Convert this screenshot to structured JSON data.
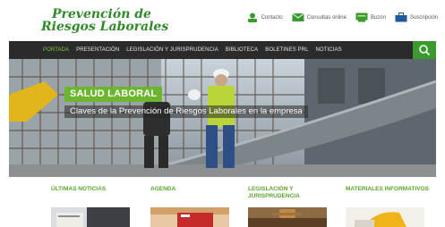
{
  "brand": {
    "logo_line1": "Prevención de",
    "logo_line2": "Riesgos Laborales",
    "accent": "#6cb52f",
    "dark_nav": "#2b2b2b"
  },
  "toplinks": [
    {
      "label": "Contacto",
      "icon": "contact-person-icon"
    },
    {
      "label": "Consultas online",
      "icon": "envelope-icon"
    },
    {
      "label": "Buzón",
      "icon": "mailbox-icon"
    },
    {
      "label": "Suscripción",
      "icon": "subscription-briefcase-icon"
    }
  ],
  "nav": {
    "items": [
      "PORTADA",
      "PRESENTACIÓN",
      "LEGISLACIÓN Y JURISPRUDENCIA",
      "BIBLIOTECA",
      "BOLETINES PRL",
      "NOTICIAS"
    ],
    "active": "PORTADA",
    "search_icon": "search-icon"
  },
  "hero": {
    "badge": "SALUD LABORAL",
    "tagline": "Claves de la Prevención de Riesgos Laborales en la empresa"
  },
  "sections": [
    {
      "title": "ÚLTIMAS NOTICIAS"
    },
    {
      "title": "AGENDA"
    },
    {
      "title": "LEGISLACIÓN Y JURISPRUDENCIA"
    },
    {
      "title": "MATERIALES INFORMATIVOS"
    }
  ]
}
